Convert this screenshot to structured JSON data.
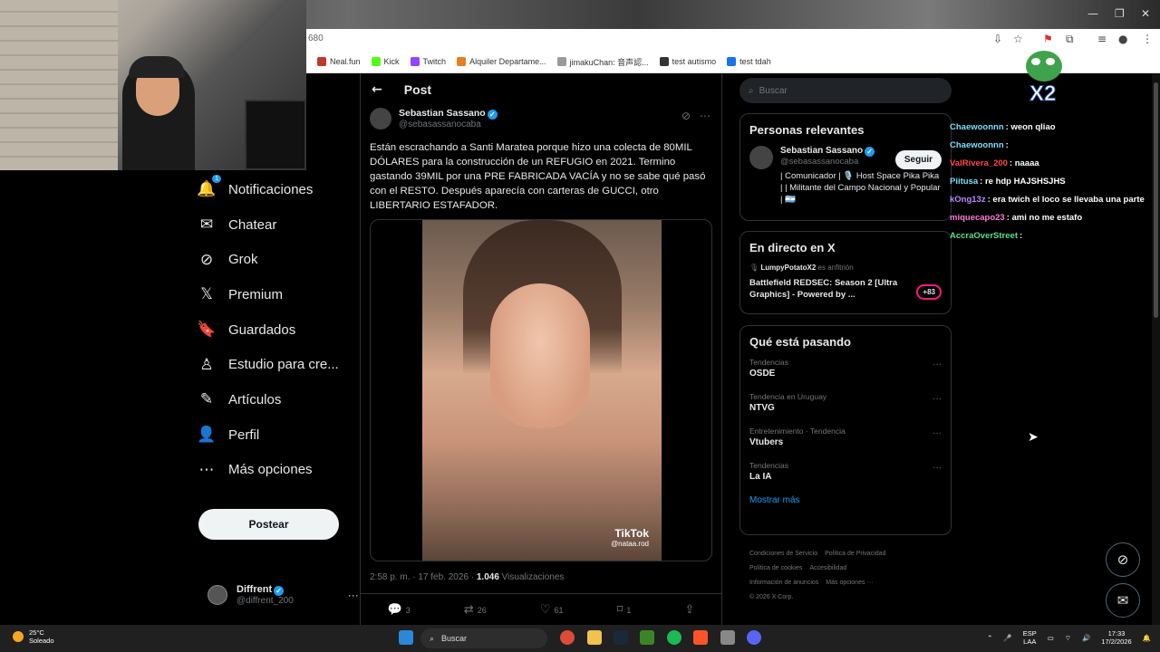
{
  "browser": {
    "url_fragment": "680",
    "bookmarks": [
      {
        "label": "Neal.fun",
        "color": "#c0392b"
      },
      {
        "label": "Kick",
        "color": "#53fc18"
      },
      {
        "label": "Twitch",
        "color": "#9146ff"
      },
      {
        "label": "Alquiler Departame...",
        "color": "#e67e22"
      },
      {
        "label": "jimakuChan: 音声認...",
        "color": "#999999"
      },
      {
        "label": "test autismo",
        "color": "#333333"
      },
      {
        "label": "test tdah",
        "color": "#1a73e8"
      }
    ]
  },
  "nav": {
    "items": [
      {
        "label": "Notificaciones",
        "icon": "bell-icon",
        "glyph": "🔔",
        "badge": "1"
      },
      {
        "label": "Chatear",
        "icon": "mail-icon",
        "glyph": "✉"
      },
      {
        "label": "Grok",
        "icon": "grok-icon",
        "glyph": "⊘"
      },
      {
        "label": "Premium",
        "icon": "x-logo-icon",
        "glyph": "𝕏"
      },
      {
        "label": "Guardados",
        "icon": "bookmark-icon",
        "glyph": "🔖"
      },
      {
        "label": "Estudio para cre...",
        "icon": "studio-icon",
        "glyph": "♙"
      },
      {
        "label": "Artículos",
        "icon": "articles-icon",
        "glyph": "✎"
      },
      {
        "label": "Perfil",
        "icon": "person-icon",
        "glyph": "👤"
      },
      {
        "label": "Más opciones",
        "icon": "more-circle-icon",
        "glyph": "⋯"
      }
    ],
    "post_button": "Postear",
    "account": {
      "name": "Diffrent",
      "handle": "@diffrent_200",
      "more": "···"
    }
  },
  "post": {
    "header": "Post",
    "author_name": "Sebastian Sassano",
    "author_handle": "@sebasassanocaba",
    "text": "Están escrachando a Santi Maratea porque hizo una colecta de 80MIL DÓLARES para la construcción de un REFUGIO en 2021. Termino gastando 39MIL por una PRE FABRICADA VACÍA y no se sabe qué pasó con el RESTO. Después aparecía con carteras de GUCCI, otro LIBERTARIO ESTAFADOR.",
    "video_brand": "TikTok",
    "video_user": "@nataa.rod",
    "time": "2:58 p. m. · 17 feb. 2026 · ",
    "views": "1.046",
    "views_label": " Visualizaciones",
    "replies": "3",
    "reposts": "26",
    "likes": "61",
    "bookmarks": "1"
  },
  "right": {
    "search_placeholder": "Buscar",
    "relevant_title": "Personas relevantes",
    "relevant": {
      "name": "Sebastian Sassano",
      "handle": "@sebasassanocaba",
      "follow": "Seguir",
      "bio": "| Comunicador | 🎙️ Host Space Pika Pika | | Militante del Campo Nacional y Popular | 🇦🇷"
    },
    "live_title": "En directo en X",
    "live": {
      "host": "LumpyPotatoX2",
      "host_suffix": "es anfitrión",
      "title": "Battlefield REDSEC: Season 2 [Ultra Graphics] - Powered by ...",
      "count": "+83"
    },
    "trends_title": "Qué está pasando",
    "trends": [
      {
        "category": "Tendencias",
        "name": "OSDE"
      },
      {
        "category": "Tendencia en Uruguay",
        "name": "NTVG"
      },
      {
        "category": "Entretenimiento · Tendencia",
        "name": "Vtubers"
      },
      {
        "category": "Tendencias",
        "name": "La IA"
      }
    ],
    "show_more": "Mostrar más",
    "footer": [
      "Condiciones de Servicio",
      "Política de Privacidad",
      "Política de cookies",
      "Accesibilidad",
      "Información de anuncios",
      "Más opciones ···",
      "© 2026 X Corp."
    ]
  },
  "chat": {
    "overlay_label": "X2",
    "messages": [
      {
        "user": "Chaewoonnn",
        "color": "#7fdfff",
        "text": ": weon qliao"
      },
      {
        "user": "Chaewoonnn",
        "color": "#7fdfff",
        "text": ":"
      },
      {
        "user": "ValRivera_200",
        "color": "#ff4a4a",
        "text": ": naaaa"
      },
      {
        "user": "Piitusa",
        "color": "#7fdfff",
        "text": ": re hdp HAJSHSJHS"
      },
      {
        "user": "kOng13z",
        "color": "#b98cff",
        "text": ": era twich el loco se llevaba una parte"
      },
      {
        "user": "miquecapo23",
        "color": "#ff7ad9",
        "text": ": ami no me estafo"
      },
      {
        "user": "AccraOverStreet",
        "color": "#5dde8a",
        "text": ":"
      }
    ]
  },
  "taskbar": {
    "temp": "25°C",
    "weather": "Soleado",
    "search": "Buscar",
    "lang1": "ESP",
    "lang2": "LAA",
    "time": "17:33",
    "date": "17/2/2026"
  }
}
